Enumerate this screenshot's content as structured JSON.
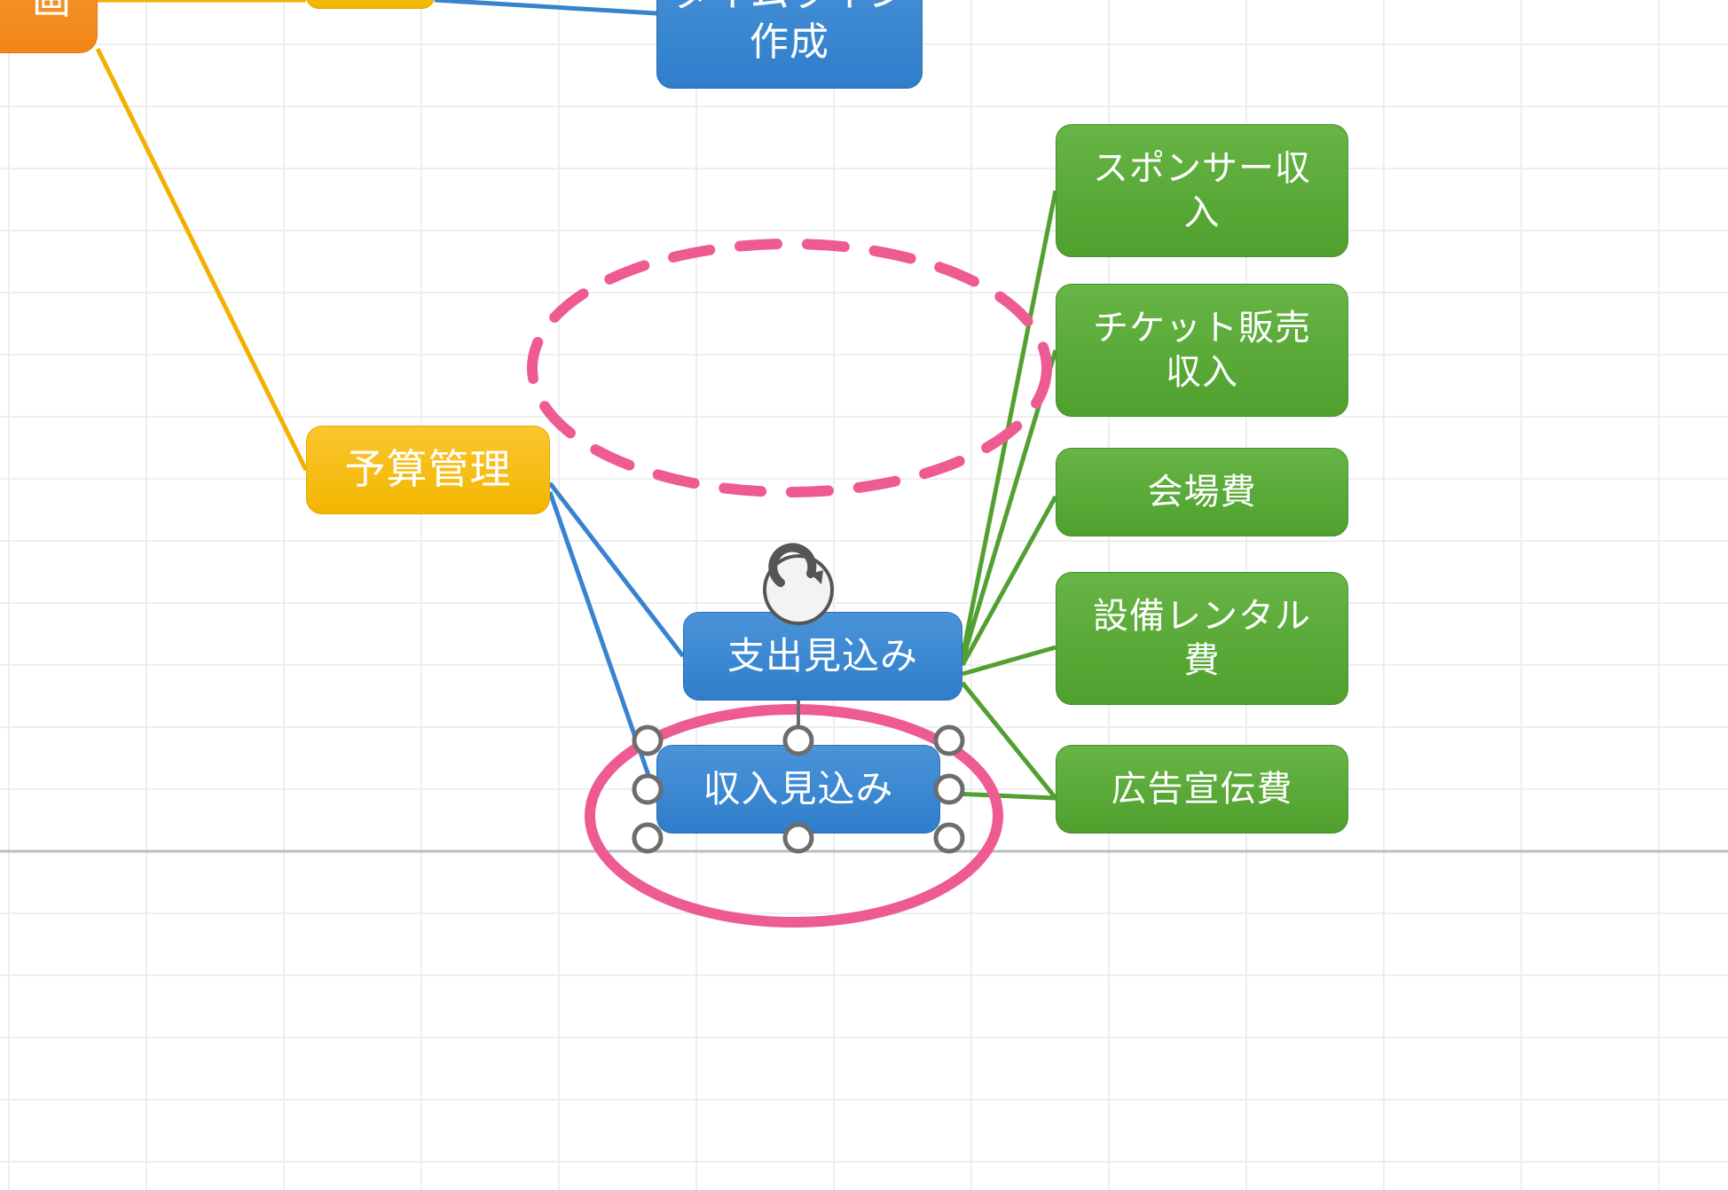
{
  "nodes": {
    "root_partial": "画",
    "timeline": "タイムライン\n作成",
    "budget": "予算管理",
    "expense": "支出見込み",
    "income": "収入見込み",
    "sponsor": "スポンサー収\n入",
    "ticket": "チケット販売\n収入",
    "venue": "会場費",
    "rental": "設備レンタル\n費",
    "advert": "広告宣伝費"
  },
  "selected_node": "income",
  "annotations": {
    "dashed_oval": "drag-target-indicator",
    "solid_oval": "selected-node-highlight"
  },
  "colors": {
    "orange": "#f28518",
    "yellow": "#f2b600",
    "blue": "#2f7ecb",
    "green": "#4fa02e",
    "pink": "#ee5a92"
  }
}
